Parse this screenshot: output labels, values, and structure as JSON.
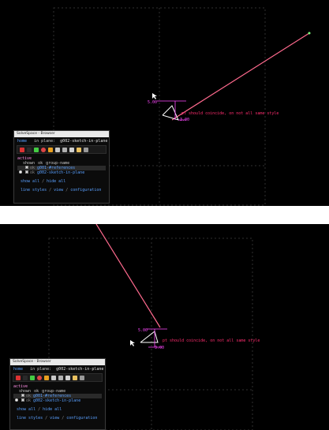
{
  "frames": [
    {
      "constraint_label": "pt should coincide, on not all same style",
      "dim1": "5.00",
      "dim2": "3.00",
      "browser": {
        "title": "SolveSpace - Browser",
        "nav_home": "home",
        "nav_label": "in plane:",
        "nav_value": "g002-sketch-in-plane",
        "active_label": "active",
        "header": [
          "shown",
          "ok",
          "group-name"
        ],
        "groups": [
          {
            "ok": "ok",
            "name": "g001-#references"
          },
          {
            "ok": "ok",
            "name": "g002-sketch-in-plane"
          }
        ],
        "show_all": "show all",
        "hide_all": "hide all",
        "links": [
          "line styles",
          "view",
          "configuration"
        ]
      }
    },
    {
      "constraint_label": "pt should coincide, on not all same style",
      "dim1": "5.00",
      "dim2": "3.00",
      "browser": {
        "title": "SolveSpace - Browser",
        "nav_home": "home",
        "nav_label": "in plane:",
        "nav_value": "g002-sketch-in-plane",
        "active_label": "active",
        "header": [
          "shown",
          "ok",
          "group-name"
        ],
        "groups": [
          {
            "ok": "ok",
            "name": "g001-#references"
          },
          {
            "ok": "ok",
            "name": "g002-sketch-in-plane"
          }
        ],
        "show_all": "show all",
        "hide_all": "hide all",
        "links": [
          "line styles",
          "view",
          "configuration"
        ]
      }
    }
  ],
  "colors": {
    "background": "#000000",
    "construction_line": "#ff6a8e",
    "dimension": "#ff48ff",
    "sketch_line": "#ffffff",
    "frame_dashed": "#2f2f2f",
    "link": "#5aa0ff"
  }
}
